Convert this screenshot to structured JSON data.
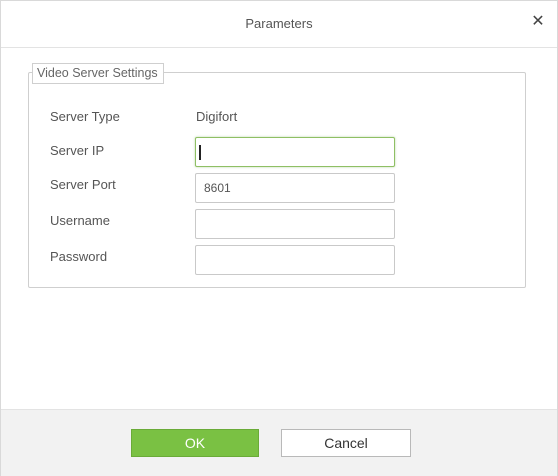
{
  "dialog": {
    "title": "Parameters",
    "close_icon": "close-icon"
  },
  "video_server": {
    "legend": "Video Server Settings",
    "server_type_label": "Server Type",
    "server_type_value": "Digifort",
    "server_ip_label": "Server IP",
    "server_ip_value": "",
    "server_port_label": "Server Port",
    "server_port_value": "8601",
    "username_label": "Username",
    "username_value": "",
    "password_label": "Password",
    "password_value": ""
  },
  "footer": {
    "ok_label": "OK",
    "cancel_label": "Cancel"
  },
  "colors": {
    "ok_button": "#7ac143",
    "focus_border": "#8fbf64"
  }
}
